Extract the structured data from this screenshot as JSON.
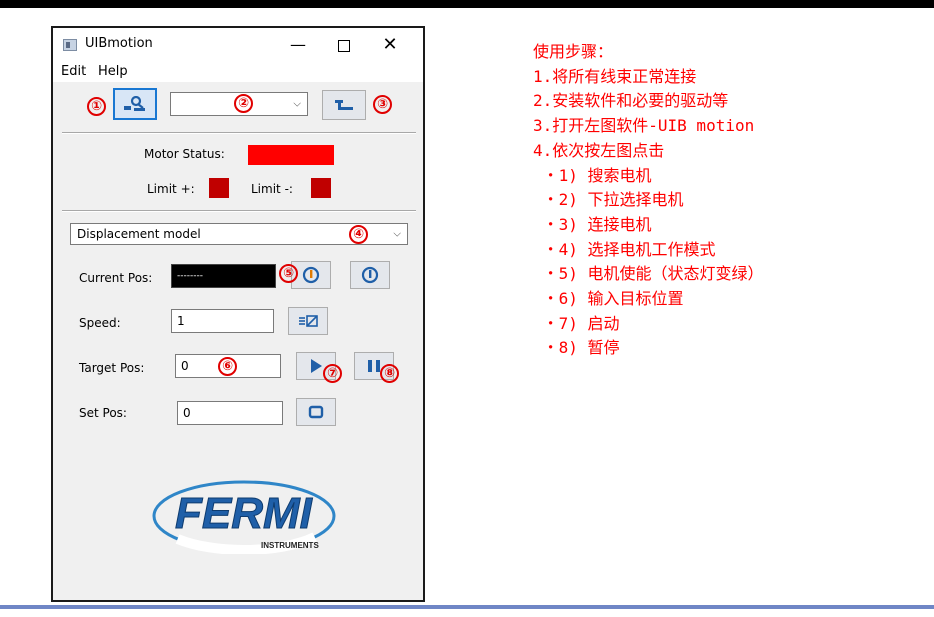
{
  "window": {
    "title": "UIBmotion",
    "controls": {
      "minimize": "—",
      "close": "✕"
    }
  },
  "menu": {
    "edit": "Edit",
    "help": "Help"
  },
  "toolbar": {
    "device_combo_value": ""
  },
  "status": {
    "motor_status_label": "Motor Status:",
    "limit_plus_label": "Limit +:",
    "limit_minus_label": "Limit -:",
    "motor_status_color": "#ff0000",
    "limit_color": "#c00000"
  },
  "mode": {
    "selected": "Displacement model"
  },
  "fields": {
    "current_pos_label": "Current Pos:",
    "current_pos_value": "--------",
    "speed_label": "Speed:",
    "speed_value": "1",
    "target_pos_label": "Target Pos:",
    "target_pos_value": "0",
    "set_pos_label": "Set Pos:",
    "set_pos_value": "0"
  },
  "logo": {
    "text": "FERMI",
    "subtext": "INSTRUMENTS"
  },
  "markers": [
    "①",
    "②",
    "③",
    "④",
    "⑤",
    "⑥",
    "⑦",
    "⑧"
  ],
  "instructions": {
    "title": "使用步骤：",
    "steps": [
      "1.将所有线束正常连接",
      "2.安装软件和必要的驱动等",
      "3.打开左图软件-UIB motion",
      "4.依次按左图点击"
    ],
    "substeps": [
      " ・1) 搜索电机",
      " ・2) 下拉选择电机",
      " ・3) 连接电机",
      " ・4) 选择电机工作模式",
      " ・5) 电机使能（状态灯变绿）",
      " ・6) 输入目标位置",
      " ・7) 启动",
      " ・8) 暂停"
    ]
  },
  "colors": {
    "annotation_red": "#ff0000",
    "accent_blue": "#1877d2",
    "icon_blue": "#1f5fa8"
  }
}
